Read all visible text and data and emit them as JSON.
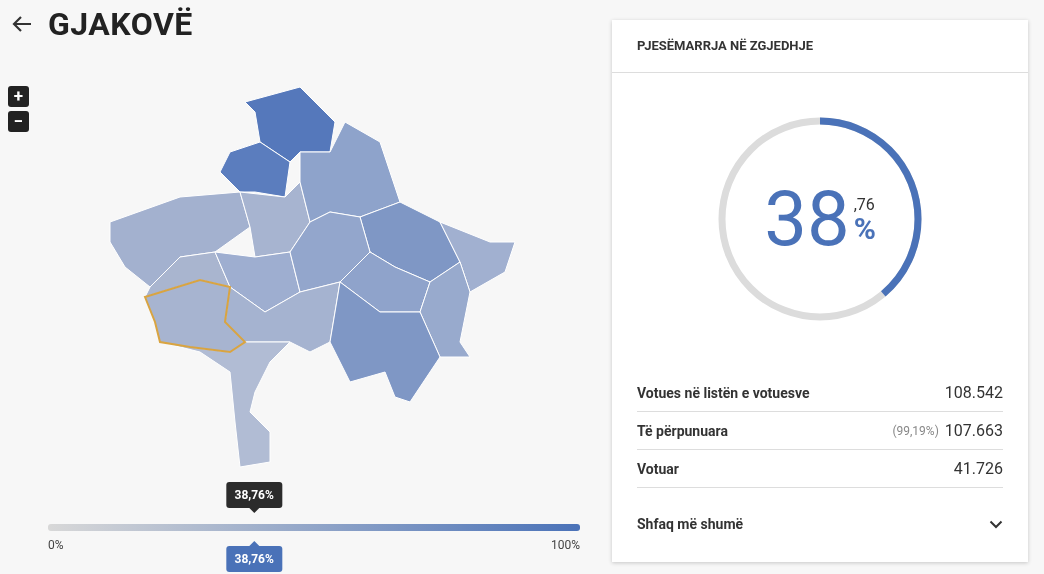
{
  "header": {
    "title": "GJAKOVË"
  },
  "map_controls": [
    "+",
    "−"
  ],
  "legend": {
    "tooltip": "38,76%",
    "min_label": "0%",
    "max_label": "100%",
    "marker": "38,76%"
  },
  "card": {
    "title": "PJESËMARRJA NË ZGJEDHJE",
    "gauge": {
      "whole": "38",
      "decimal": ",76",
      "unit": "%"
    },
    "stats": [
      {
        "label": "Votues në listën e votuesve",
        "value": "108.542"
      },
      {
        "label": "Të përpunuara",
        "note": "(99,19%)",
        "value": "107.663"
      },
      {
        "label": "Votuar",
        "value": "41.726"
      }
    ],
    "more": {
      "label": "Shfaq më shumë",
      "expanded": false
    }
  }
}
